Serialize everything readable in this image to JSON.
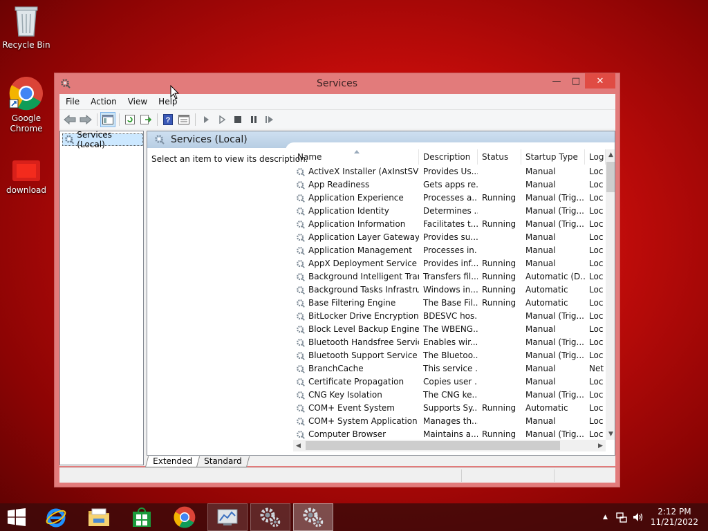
{
  "desktop": {
    "icons": [
      {
        "label": "Recycle Bin",
        "icon": "recycle-bin-icon"
      },
      {
        "label": "Google Chrome",
        "icon": "chrome-icon"
      },
      {
        "label": "download",
        "icon": "download-folder-icon"
      }
    ]
  },
  "window": {
    "title": "Services",
    "menu": [
      "File",
      "Action",
      "View",
      "Help"
    ],
    "tree": {
      "selected": "Services (Local)"
    },
    "pane": {
      "header": "Services (Local)",
      "description_prompt": "Select an item to view its description.",
      "columns": [
        "Name",
        "Description",
        "Status",
        "Startup Type",
        "Log"
      ],
      "rows": [
        {
          "name": "ActiveX Installer (AxInstSV)",
          "desc": "Provides Us...",
          "status": "",
          "startup": "Manual",
          "log": "Loc"
        },
        {
          "name": "App Readiness",
          "desc": "Gets apps re...",
          "status": "",
          "startup": "Manual",
          "log": "Loc"
        },
        {
          "name": "Application Experience",
          "desc": "Processes a...",
          "status": "Running",
          "startup": "Manual (Trig...",
          "log": "Loc"
        },
        {
          "name": "Application Identity",
          "desc": "Determines ...",
          "status": "",
          "startup": "Manual (Trig...",
          "log": "Loc"
        },
        {
          "name": "Application Information",
          "desc": "Facilitates t...",
          "status": "Running",
          "startup": "Manual (Trig...",
          "log": "Loc"
        },
        {
          "name": "Application Layer Gateway ...",
          "desc": "Provides su...",
          "status": "",
          "startup": "Manual",
          "log": "Loc"
        },
        {
          "name": "Application Management",
          "desc": "Processes in...",
          "status": "",
          "startup": "Manual",
          "log": "Loc"
        },
        {
          "name": "AppX Deployment Service (...",
          "desc": "Provides inf...",
          "status": "Running",
          "startup": "Manual",
          "log": "Loc"
        },
        {
          "name": "Background Intelligent Tran...",
          "desc": "Transfers fil...",
          "status": "Running",
          "startup": "Automatic (D...",
          "log": "Loc"
        },
        {
          "name": "Background Tasks Infrastru...",
          "desc": "Windows in...",
          "status": "Running",
          "startup": "Automatic",
          "log": "Loc"
        },
        {
          "name": "Base Filtering Engine",
          "desc": "The Base Fil...",
          "status": "Running",
          "startup": "Automatic",
          "log": "Loc"
        },
        {
          "name": "BitLocker Drive Encryption ...",
          "desc": "BDESVC hos...",
          "status": "",
          "startup": "Manual (Trig...",
          "log": "Loc"
        },
        {
          "name": "Block Level Backup Engine ...",
          "desc": "The WBENG...",
          "status": "",
          "startup": "Manual",
          "log": "Loc"
        },
        {
          "name": "Bluetooth Handsfree Service",
          "desc": "Enables wir...",
          "status": "",
          "startup": "Manual (Trig...",
          "log": "Loc"
        },
        {
          "name": "Bluetooth Support Service",
          "desc": "The Bluetoo...",
          "status": "",
          "startup": "Manual (Trig...",
          "log": "Loc"
        },
        {
          "name": "BranchCache",
          "desc": "This service ...",
          "status": "",
          "startup": "Manual",
          "log": "Net"
        },
        {
          "name": "Certificate Propagation",
          "desc": "Copies user ...",
          "status": "",
          "startup": "Manual",
          "log": "Loc"
        },
        {
          "name": "CNG Key Isolation",
          "desc": "The CNG ke...",
          "status": "",
          "startup": "Manual (Trig...",
          "log": "Loc"
        },
        {
          "name": "COM+ Event System",
          "desc": "Supports Sy...",
          "status": "Running",
          "startup": "Automatic",
          "log": "Loc"
        },
        {
          "name": "COM+ System Application",
          "desc": "Manages th...",
          "status": "",
          "startup": "Manual",
          "log": "Loc"
        },
        {
          "name": "Computer Browser",
          "desc": "Maintains a...",
          "status": "Running",
          "startup": "Manual (Trig...",
          "log": "Loc"
        }
      ]
    },
    "tabs": [
      "Extended",
      "Standard"
    ]
  },
  "taskbar": {
    "items": [
      "start-button",
      "internet-explorer-icon",
      "file-explorer-icon",
      "store-icon",
      "chrome-icon",
      "server-manager-icon",
      "services-icon",
      "services-icon"
    ],
    "clock": {
      "time": "2:12 PM",
      "date": "11/21/2022"
    }
  },
  "colors": {
    "window_frame": "#e27b7b",
    "close_button": "#e04b43",
    "selection": "#cce8ff"
  }
}
